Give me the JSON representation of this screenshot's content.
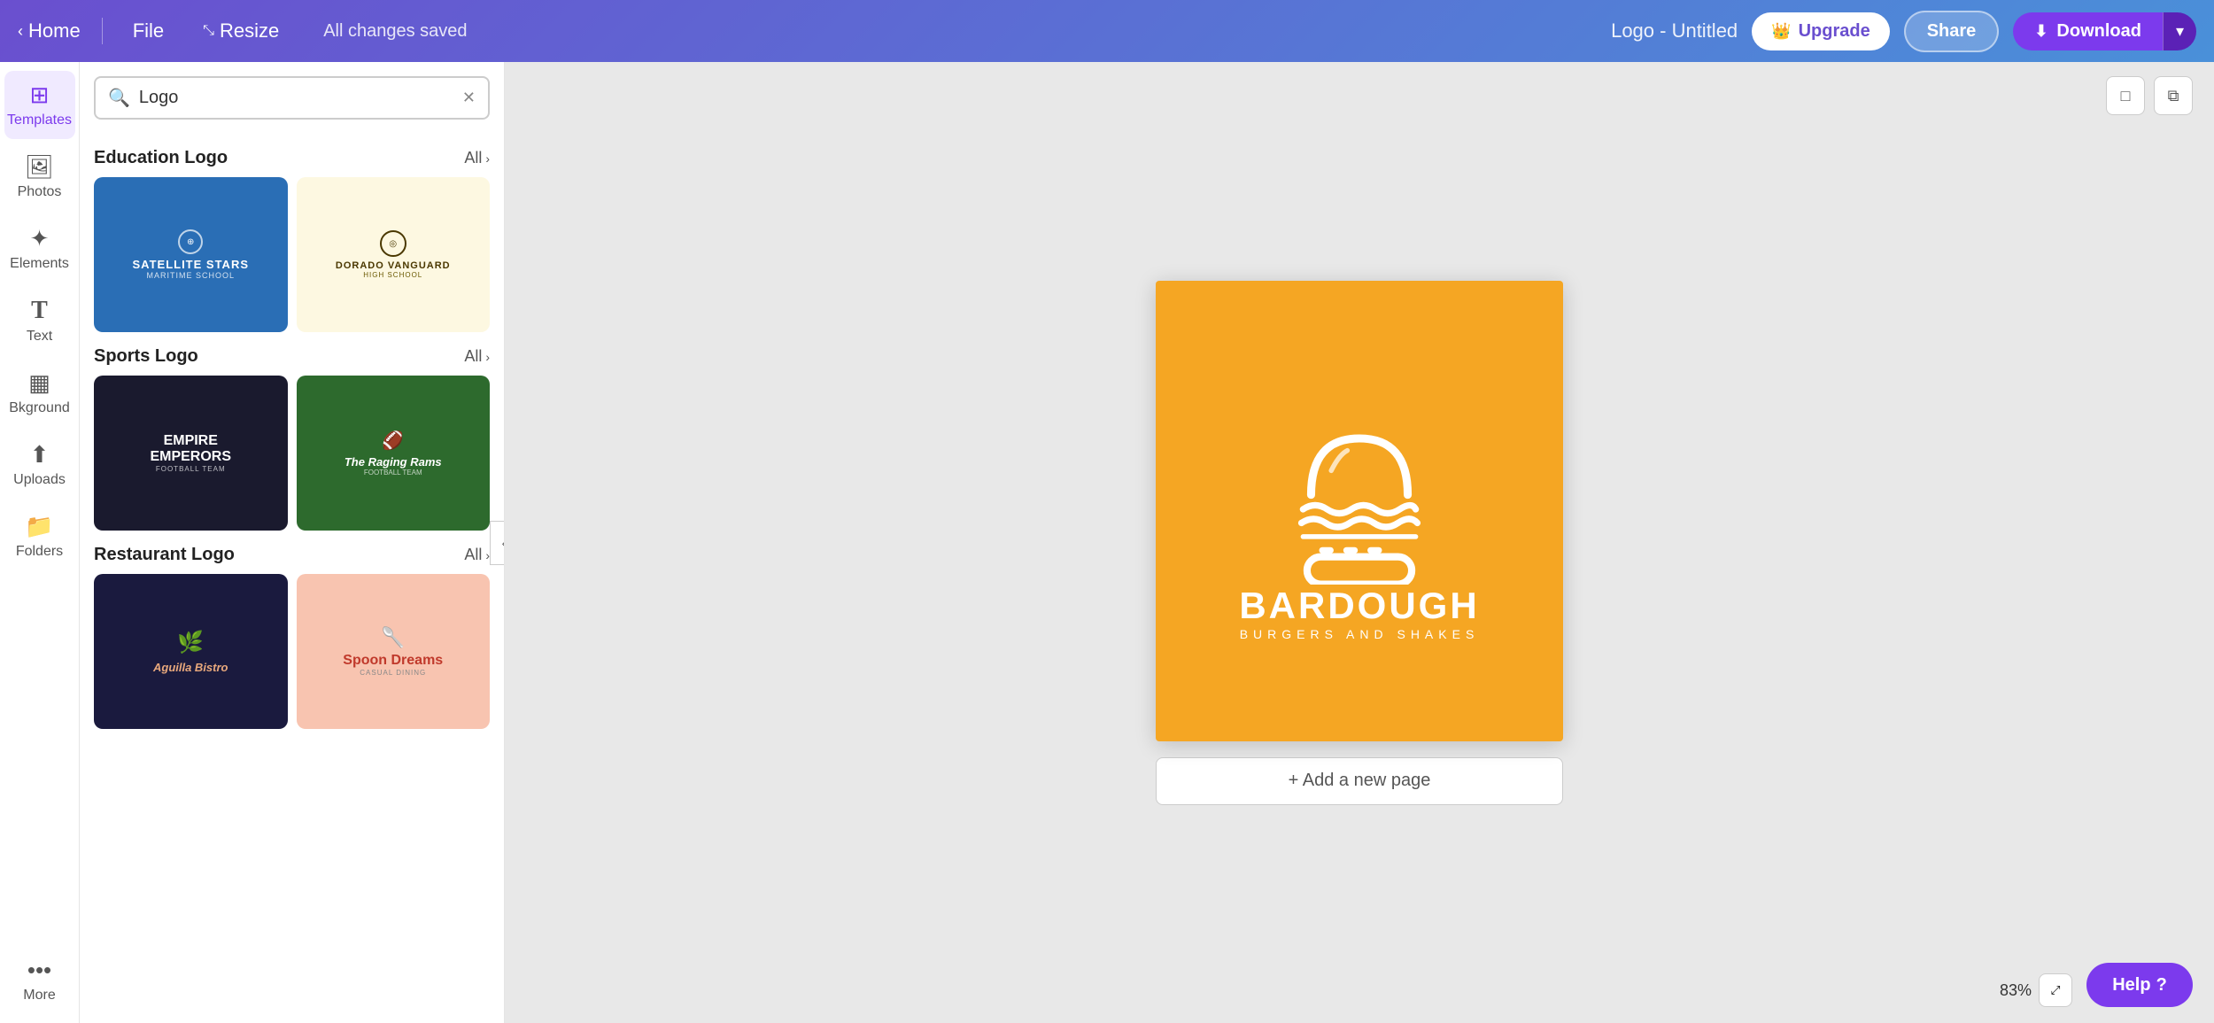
{
  "topbar": {
    "home_label": "Home",
    "file_label": "File",
    "resize_label": "Resize",
    "saved_text": "All changes saved",
    "doc_title": "Logo - Untitled",
    "upgrade_label": "Upgrade",
    "share_label": "Share",
    "download_label": "Download"
  },
  "sidebar": {
    "items": [
      {
        "id": "templates",
        "icon": "⊞",
        "label": "Templates",
        "active": true
      },
      {
        "id": "photos",
        "icon": "🖼",
        "label": "Photos",
        "active": false
      },
      {
        "id": "elements",
        "icon": "❖",
        "label": "Elements",
        "active": false
      },
      {
        "id": "text",
        "icon": "T",
        "label": "Text",
        "active": false
      },
      {
        "id": "background",
        "icon": "▦",
        "label": "Bkground",
        "active": false
      },
      {
        "id": "uploads",
        "icon": "⬆",
        "label": "Uploads",
        "active": false
      },
      {
        "id": "folders",
        "icon": "📁",
        "label": "Folders",
        "active": false
      },
      {
        "id": "more",
        "icon": "•••",
        "label": "More",
        "active": false
      }
    ]
  },
  "templates_panel": {
    "search_placeholder": "Logo",
    "sections": [
      {
        "id": "education",
        "title": "Education Logo",
        "all_label": "All",
        "templates": [
          {
            "id": "edu1",
            "style": "edu-1",
            "name": "SATELLITE STARS",
            "sub": "MARITIME SCHOOL"
          },
          {
            "id": "edu2",
            "style": "edu-2",
            "name": "DORADO VANGUARD",
            "sub": "HIGH SCHOOL"
          }
        ]
      },
      {
        "id": "sports",
        "title": "Sports Logo",
        "all_label": "All",
        "templates": [
          {
            "id": "sp1",
            "style": "sports-1",
            "name": "EMPIRE EMPERORS",
            "sub": "FOOTBALL TEAM"
          },
          {
            "id": "sp2",
            "style": "sports-2",
            "name": "The Raging Rams",
            "sub": "FOOTBALL TEAM"
          }
        ]
      },
      {
        "id": "restaurant",
        "title": "Restaurant Logo",
        "all_label": "All",
        "templates": [
          {
            "id": "rest1",
            "style": "rest-1",
            "name": "Aguilla Bistro",
            "sub": ""
          },
          {
            "id": "rest2",
            "style": "rest-2",
            "name": "Spoon Dreams",
            "sub": "CASUAL DINING"
          }
        ]
      }
    ]
  },
  "canvas": {
    "brand_name": "BARDOUGH",
    "brand_tagline": "BURGERS AND SHAKES",
    "add_page_label": "+ Add a new page",
    "zoom": "83%"
  },
  "help_button": {
    "label": "Help",
    "icon": "?"
  }
}
